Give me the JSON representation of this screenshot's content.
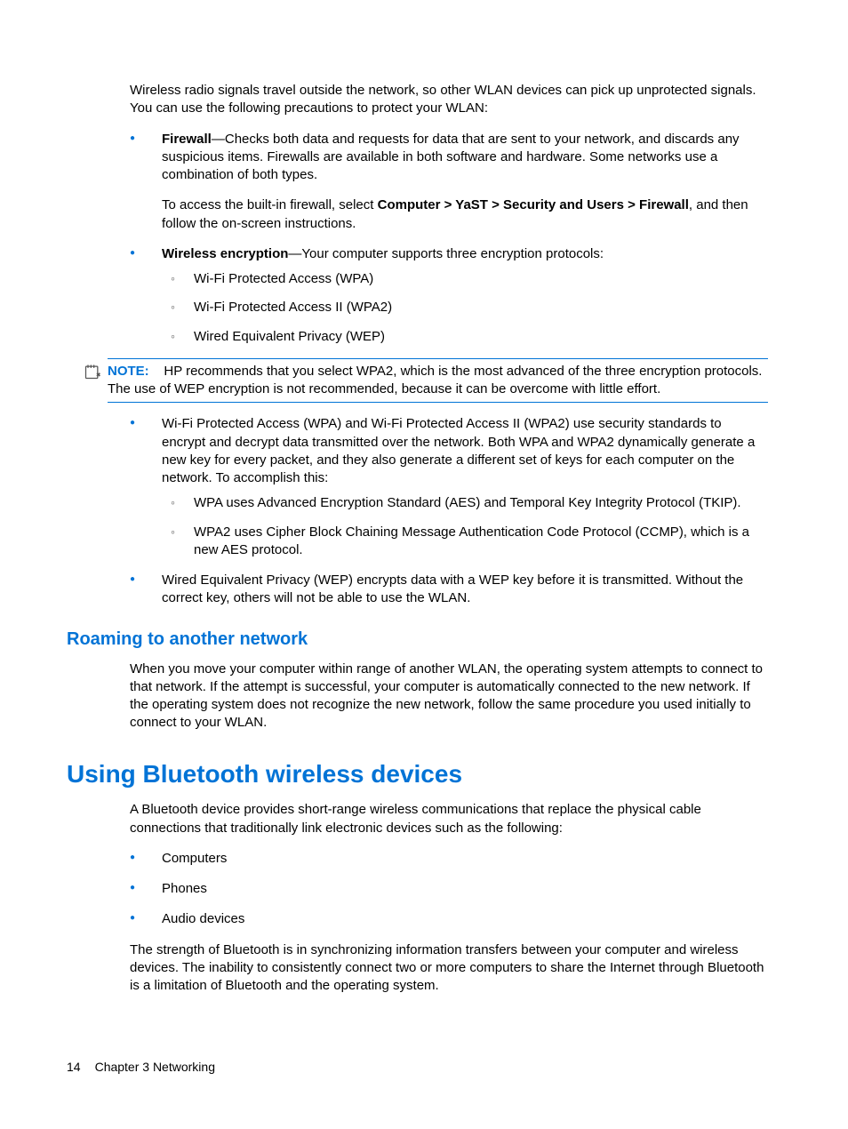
{
  "intro": "Wireless radio signals travel outside the network, so other WLAN devices can pick up unprotected signals. You can use the following precautions to protect your WLAN:",
  "firewall": {
    "label": "Firewall",
    "desc": "—Checks both data and requests for data that are sent to your network, and discards any suspicious items. Firewalls are available in both software and hardware. Some networks use a combination of both types.",
    "access_pre": "To access the built-in firewall, select ",
    "access_path": "Computer > YaST > Security and Users > Firewall",
    "access_post": ", and then follow the on-screen instructions."
  },
  "encryption": {
    "label": "Wireless encryption",
    "desc": "—Your computer supports three encryption protocols:",
    "protocols": [
      "Wi-Fi Protected Access (WPA)",
      "Wi-Fi Protected Access II (WPA2)",
      "Wired Equivalent Privacy (WEP)"
    ]
  },
  "note": {
    "label": "NOTE:",
    "text": "HP recommends that you select WPA2, which is the most advanced of the three encryption protocols. The use of WEP encryption is not recommended, because it can be overcome with little effort."
  },
  "wpa_item": {
    "desc": "Wi-Fi Protected Access (WPA) and Wi-Fi Protected Access II (WPA2) use security standards to encrypt and decrypt data transmitted over the network. Both WPA and WPA2 dynamically generate a new key for every packet, and they also generate a different set of keys for each computer on the network. To accomplish this:",
    "subs": [
      "WPA uses Advanced Encryption Standard (AES) and Temporal Key Integrity Protocol (TKIP).",
      "WPA2 uses Cipher Block Chaining Message Authentication Code Protocol (CCMP), which is a new AES protocol."
    ]
  },
  "wep_item": "Wired Equivalent Privacy (WEP) encrypts data with a WEP key before it is transmitted. Without the correct key, others will not be able to use the WLAN.",
  "roaming": {
    "heading": "Roaming to another network",
    "text": "When you move your computer within range of another WLAN, the operating system attempts to connect to that network. If the attempt is successful, your computer is automatically connected to the new network. If the operating system does not recognize the new network, follow the same procedure you used initially to connect to your WLAN."
  },
  "bluetooth": {
    "heading": "Using Bluetooth wireless devices",
    "intro": "A Bluetooth device provides short-range wireless communications that replace the physical cable connections that traditionally link electronic devices such as the following:",
    "items": [
      "Computers",
      "Phones",
      "Audio devices"
    ],
    "outro": "The strength of Bluetooth is in synchronizing information transfers between your computer and wireless devices. The inability to consistently connect two or more computers to share the Internet through Bluetooth is a limitation of Bluetooth and the operating system."
  },
  "footer": {
    "page": "14",
    "chapter": "Chapter 3   Networking"
  }
}
